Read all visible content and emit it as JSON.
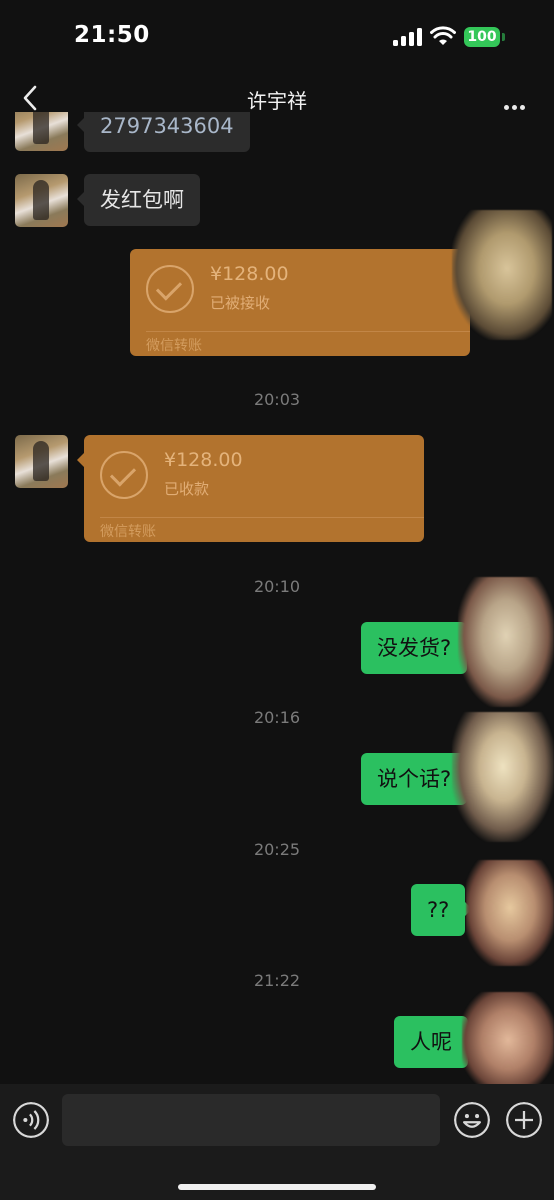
{
  "status_bar": {
    "time": "21:50",
    "battery": "100"
  },
  "nav": {
    "title": "许宇祥"
  },
  "messages": {
    "partial_number": "2797343604",
    "request_text": "发红包啊",
    "transfer_out": {
      "amount": "¥128.00",
      "status": "已被接收",
      "label": "微信转账"
    },
    "time_1": "20:03",
    "transfer_in": {
      "amount": "¥128.00",
      "status": "已收款",
      "label": "微信转账"
    },
    "time_2": "20:10",
    "msg_1": "没发货?",
    "time_3": "20:16",
    "msg_2": "说个话?",
    "time_4": "20:25",
    "msg_3": "??",
    "time_5": "21:22",
    "msg_4": "人呢"
  },
  "colors": {
    "accent_green": "#2bc060",
    "transfer_orange": "#b2732e",
    "background": "#111111"
  },
  "icons": [
    "back-chevron-icon",
    "more-dots-icon",
    "voice-icon",
    "emoji-icon",
    "plus-icon",
    "signal-icon",
    "wifi-icon",
    "battery-icon",
    "transfer-check-icon"
  ]
}
